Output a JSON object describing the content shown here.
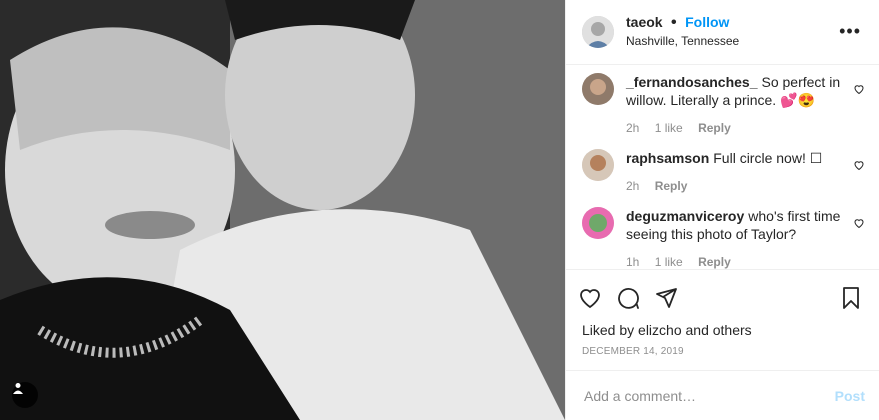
{
  "post": {
    "username": "taeok",
    "follow_label": "Follow",
    "location": "Nashville, Tennessee",
    "more_label": "•••"
  },
  "comments": [
    {
      "username": "_fernandosanches_",
      "text": "So perfect in willow. Literally a prince. 💕😍",
      "time": "2h",
      "likes": "1 like",
      "reply": "Reply"
    },
    {
      "username": "raphsamson",
      "text": "Full circle now! ☐",
      "time": "2h",
      "likes": "",
      "reply": "Reply"
    },
    {
      "username": "deguzmanviceroy",
      "text": "who's first time seeing this photo of Taylor?",
      "time": "1h",
      "likes": "1 like",
      "reply": "Reply"
    }
  ],
  "actions": {
    "liked_by": "Liked by elizcho and others",
    "date": "DECEMBER 14, 2019"
  },
  "composer": {
    "placeholder": "Add a comment…",
    "post_label": "Post"
  },
  "colors": {
    "accent": "#0095f6",
    "post_disabled": "#b2dffc"
  }
}
